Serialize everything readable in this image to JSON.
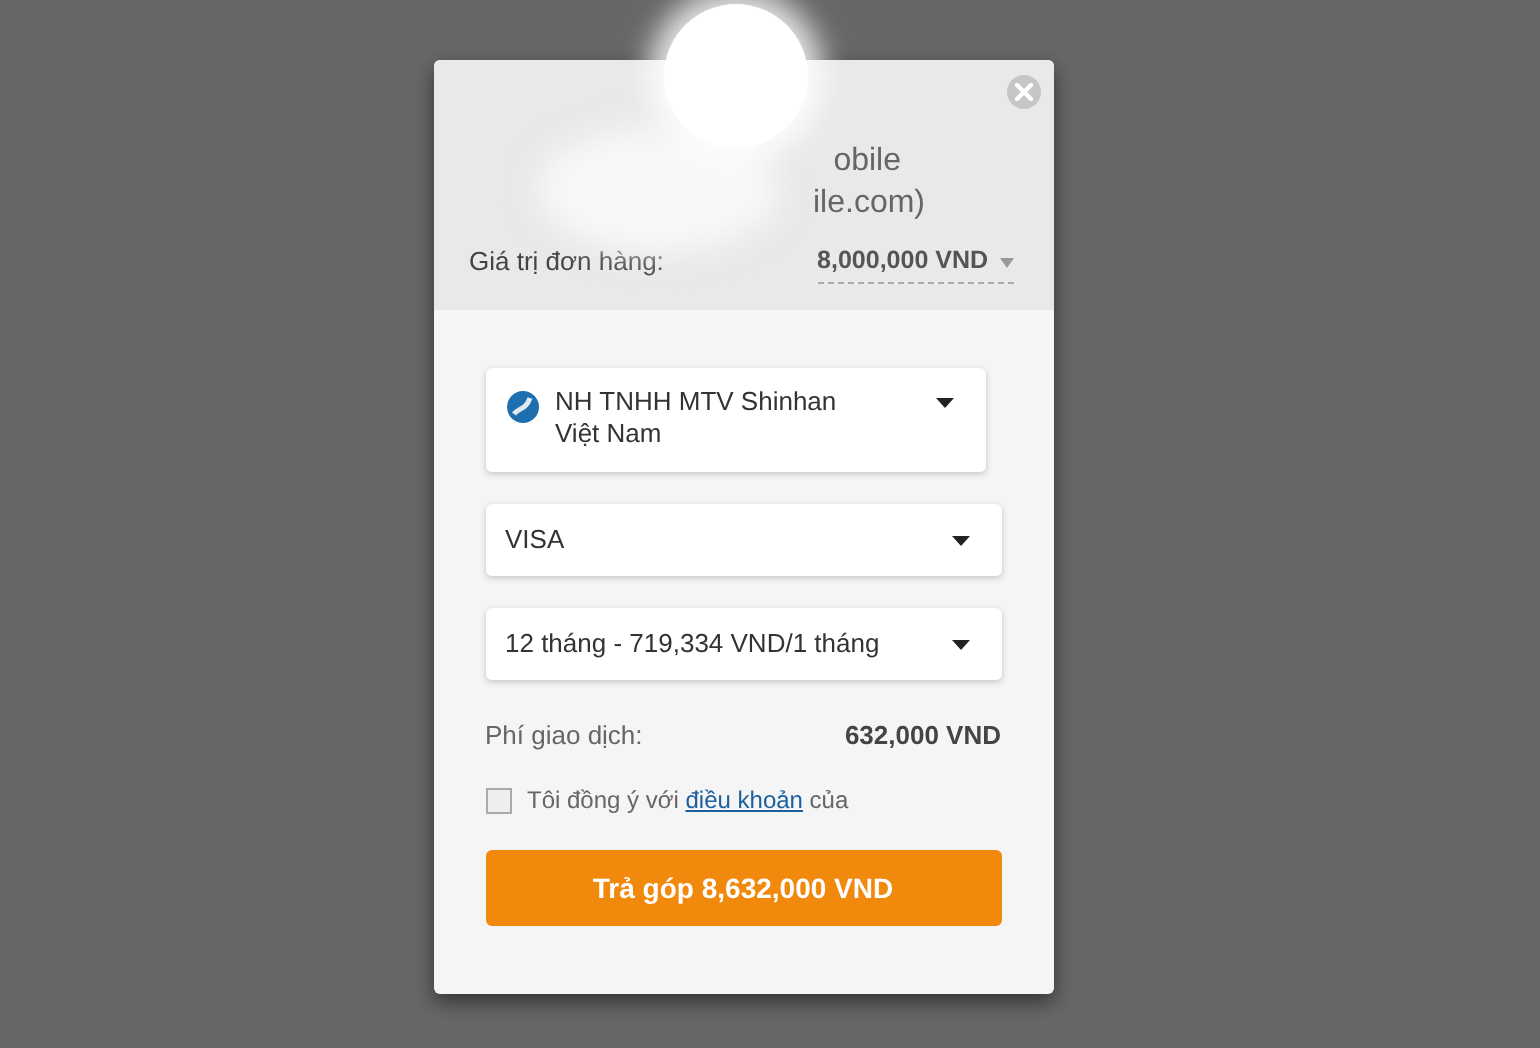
{
  "header": {
    "title_lines": [
      "obile",
      "ile.com)"
    ],
    "order_label": "Giá trị đơn hàng:",
    "order_value": "8,000,000 VND"
  },
  "selects": [
    {
      "kind": "bank",
      "value": "NH TNHH MTV Shinhan Việt Nam"
    },
    {
      "kind": "plain",
      "value": "VISA"
    },
    {
      "kind": "plain",
      "value": "12 tháng - 719,334 VND/1 tháng"
    }
  ],
  "fee": {
    "label": "Phí giao dịch:",
    "value": "632,000 VND"
  },
  "agree": {
    "checked": false,
    "before": "Tôi đồng ý với",
    "link": "điều khoản",
    "after": "của"
  },
  "submit": "Trả góp 8,632,000 VND"
}
